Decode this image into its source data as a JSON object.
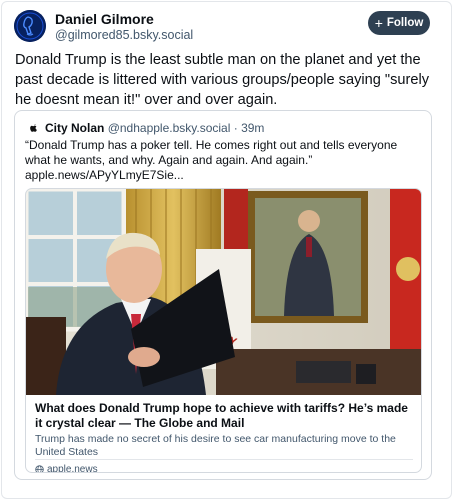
{
  "post": {
    "author": {
      "display_name": "Daniel Gilmore",
      "handle": "@gilmored85.bsky.social",
      "avatar": "blue-avatar-with-figure-icon"
    },
    "follow_label": "Follow",
    "text": "Donald Trump is the least subtle man on the planet and yet the past decade is littered with various groups/people saying \"surely he doesnt mean it!\" over and over again."
  },
  "quote": {
    "author": {
      "display_name": "City Nolan",
      "handle": "@ndhapple.bsky.social",
      "separator": "·",
      "time": "39m"
    },
    "text": "“Donald Trump has a poker tell. He comes right out and tells everyone what he wants, and why. Again and again. And again.”",
    "link": "apple.news/APyYLmyE7Sie...",
    "embed": {
      "title": "What does Donald Trump hope to achieve with tariffs? He’s made it crystal clear — The Globe and Mail",
      "description": "Trump has made no secret of his desire to see car manufacturing move to the United States",
      "domain": "apple.news",
      "domain_icon": "globe-icon"
    }
  },
  "colors": {
    "text": "#0b0f14",
    "muted": "#42576c",
    "follow_button": "#2e4052",
    "border": "#d4d9df",
    "avatar_bg": "#07215f"
  }
}
